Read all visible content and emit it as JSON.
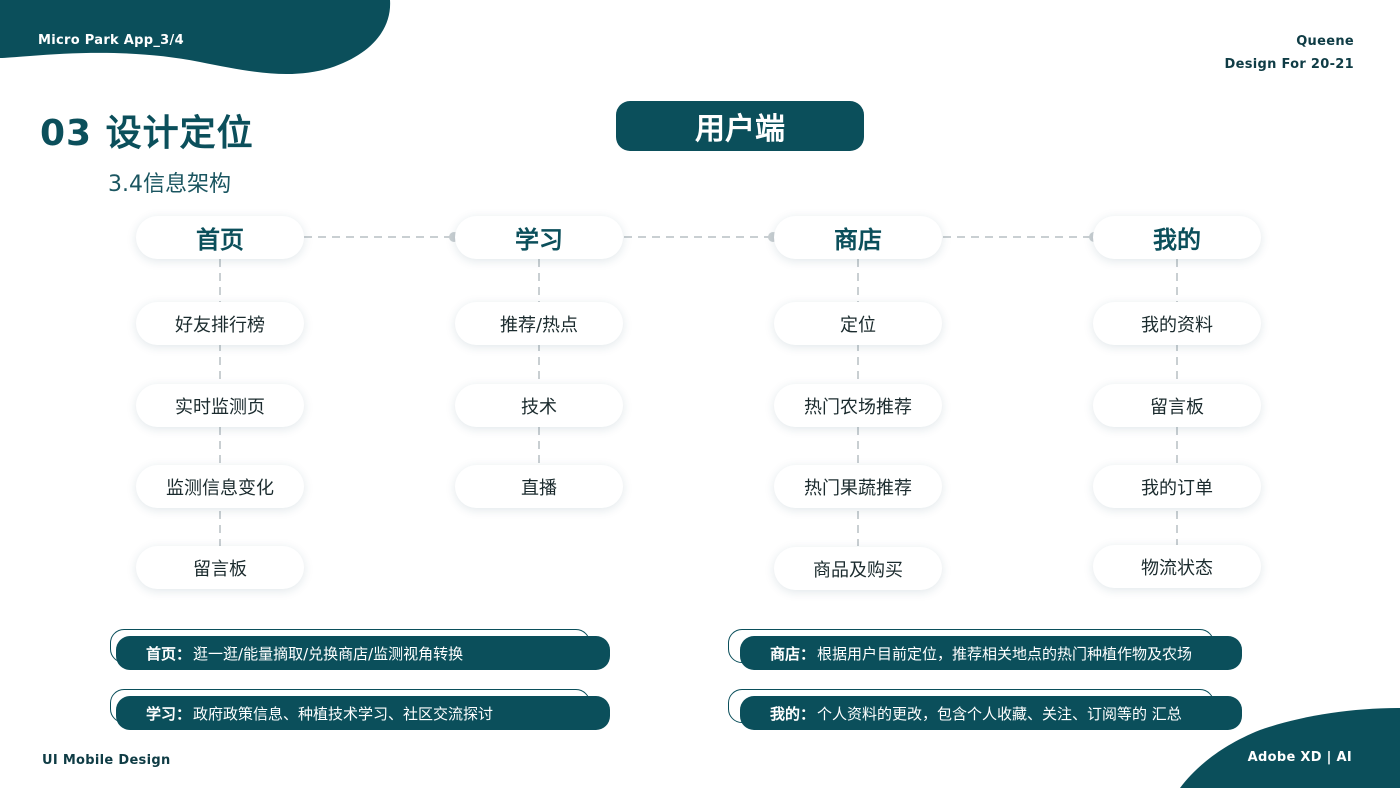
{
  "header": {
    "app_name": "Micro Park App_3/4",
    "author": "Queene",
    "design_for": "Design For 20-21"
  },
  "footer": {
    "left": "UI Mobile Design",
    "right": "Adobe XD | AI"
  },
  "title": "03 设计定位",
  "subtitle": "3.4信息架构",
  "main_label": "用户端",
  "columns": [
    {
      "head": "首页",
      "items": [
        "好友排行榜",
        "实时监测页",
        "监测信息变化",
        "留言板"
      ]
    },
    {
      "head": "学习",
      "items": [
        "推荐/热点",
        "技术",
        "直播"
      ]
    },
    {
      "head": "商店",
      "items": [
        "定位",
        "热门农场推荐",
        "热门果蔬推荐",
        "商品及购买"
      ]
    },
    {
      "head": "我的",
      "items": [
        "我的资料",
        "留言板",
        "我的订单",
        "物流状态"
      ]
    }
  ],
  "notes": [
    {
      "label": "首页：",
      "text": "逛一逛/能量摘取/兑换商店/监测视角转换"
    },
    {
      "label": "学习：",
      "text": "政府政策信息、种植技术学习、社区交流探讨"
    },
    {
      "label": "商店：",
      "text": "根据用户目前定位，推荐相关地点的热门种植作物及农场"
    },
    {
      "label": "我的：",
      "text": "个人资料的更改，包含个人收藏、关注、订阅等的 汇总"
    }
  ],
  "colors": {
    "primary": "#0b4f5b",
    "line": "#c9cfd2"
  }
}
